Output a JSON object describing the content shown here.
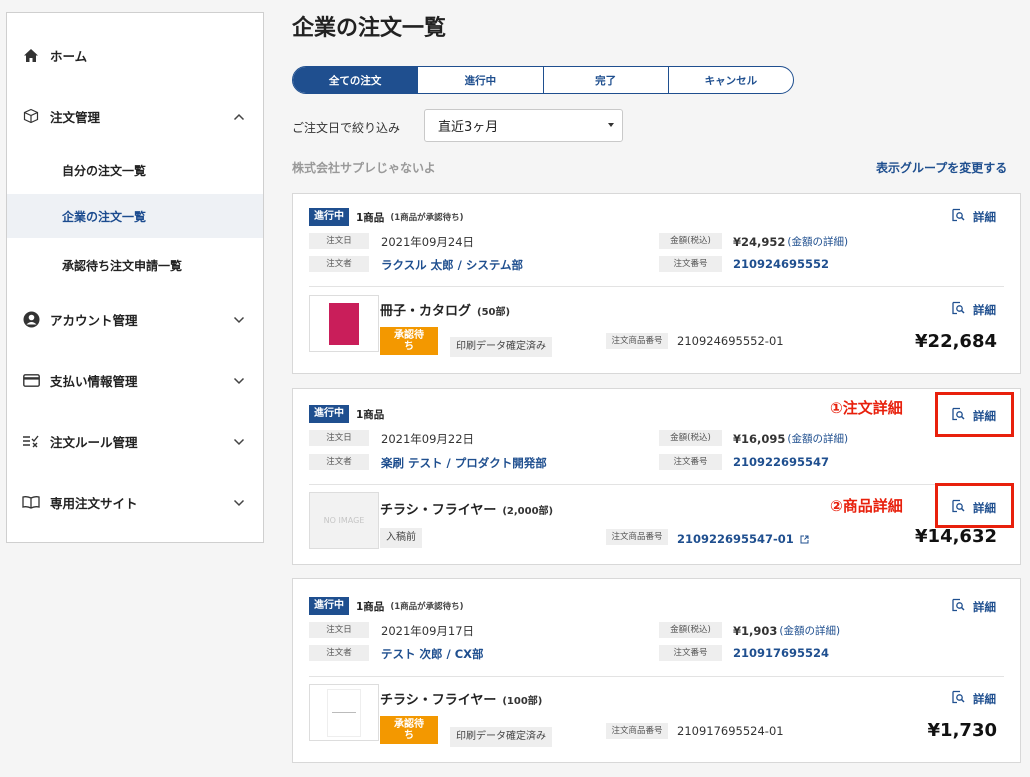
{
  "sidebar": {
    "items": [
      {
        "label": "ホーム",
        "icon": "home-icon"
      },
      {
        "label": "注文管理",
        "icon": "box-icon"
      },
      {
        "label": "アカウント管理",
        "icon": "account-icon"
      },
      {
        "label": "支払い情報管理",
        "icon": "card-icon"
      },
      {
        "label": "注文ルール管理",
        "icon": "rule-icon"
      },
      {
        "label": "専用注文サイト",
        "icon": "book-icon"
      }
    ],
    "sub_items": [
      {
        "label": "自分の注文一覧",
        "active": false
      },
      {
        "label": "企業の注文一覧",
        "active": true
      },
      {
        "label": "承認待ち注文申請一覧",
        "active": false
      }
    ]
  },
  "page": {
    "title": "企業の注文一覧"
  },
  "tabs": [
    {
      "label": "全ての注文",
      "active": true
    },
    {
      "label": "進行中",
      "active": false
    },
    {
      "label": "完了",
      "active": false
    },
    {
      "label": "キャンセル",
      "active": false
    }
  ],
  "filter": {
    "label": "ご注文日で絞り込み",
    "selected": "直近3ヶ月"
  },
  "company": {
    "name": "株式会社サプレじゃないよ",
    "change_group": "表示グループを変更する"
  },
  "labels": {
    "order_date": "注文日",
    "orderer": "注文者",
    "amount": "金額(税込)",
    "order_no": "注文番号",
    "item_no": "注文商品番号",
    "detail": "詳細",
    "amount_detail": "(金額の詳細)"
  },
  "orders": [
    {
      "status": "進行中",
      "count": "1商品",
      "count_sub": "(1商品が承認待ち)",
      "date": "2021年09月24日",
      "orderer": "ラクスル 太郎 / システム部",
      "amount": "¥24,952",
      "order_no": "210924695552",
      "product": {
        "name": "冊子・カタログ",
        "qty": "(50部)",
        "status_badge": "承認待ち",
        "state": "印刷データ確定済み",
        "item_no": "210924695552-01",
        "price": "¥22,684",
        "thumb": "catalog"
      }
    },
    {
      "status": "進行中",
      "count": "1商品",
      "count_sub": "",
      "date": "2021年09月22日",
      "orderer": "楽刷 テスト / プロダクト開発部",
      "amount": "¥16,095",
      "order_no": "210922695547",
      "product": {
        "name": "チラシ・フライヤー",
        "qty": "(2,000部)",
        "status_badge": "",
        "state": "入稿前",
        "item_no": "210922695547-01",
        "price": "¥14,632",
        "thumb": "NO IMAGE"
      }
    },
    {
      "status": "進行中",
      "count": "1商品",
      "count_sub": "(1商品が承認待ち)",
      "date": "2021年09月17日",
      "orderer": "テスト 次郎 / CX部",
      "amount": "¥1,903",
      "order_no": "210917695524",
      "product": {
        "name": "チラシ・フライヤー",
        "qty": "(100部)",
        "status_badge": "承認待ち",
        "state": "印刷データ確定済み",
        "item_no": "210917695524-01",
        "price": "¥1,730",
        "thumb": "flyer"
      }
    }
  ],
  "annotations": {
    "order_detail": "①注文詳細",
    "product_detail": "②商品詳細",
    "color": "#e8200c"
  },
  "colors": {
    "primary": "#1f4f8f",
    "orange": "#f39800"
  }
}
